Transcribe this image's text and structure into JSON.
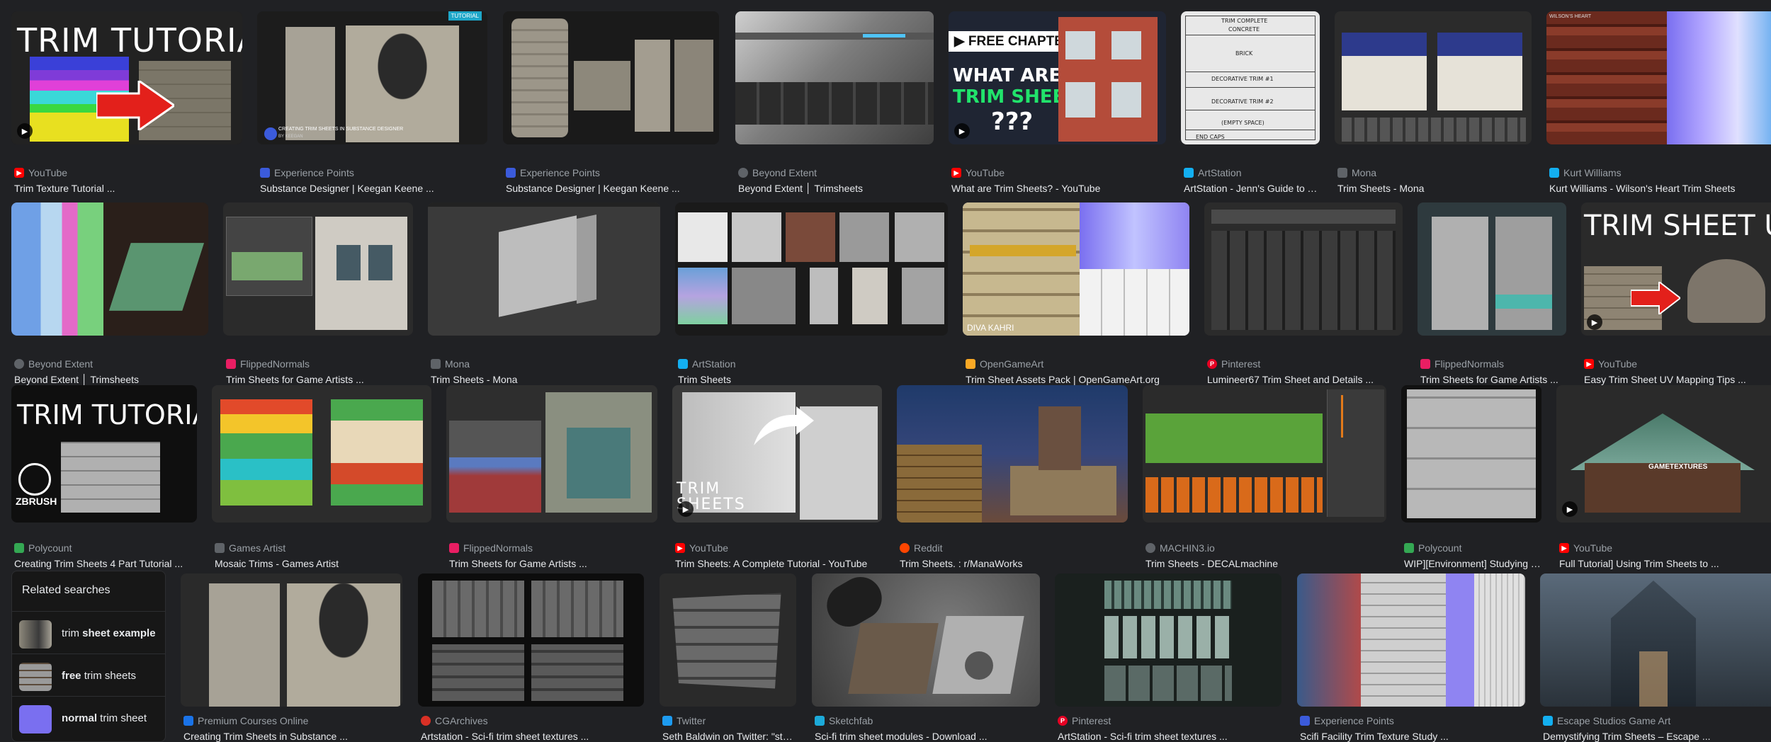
{
  "row1": [
    {
      "source": "YouTube",
      "title": "Trim Texture Tutorial ...",
      "fav": "#ff0000",
      "overlay": "TRIM TUTORIAL",
      "video": true
    },
    {
      "source": "Experience Points",
      "title": "Substance Designer | Keegan Keene ...",
      "fav": "#3b5bdb",
      "badge": "TUTORIAL",
      "caption": "CREATING TRIM SHEETS IN SUBSTANCE DESIGNER",
      "caption2": "BY KEEGAN"
    },
    {
      "source": "Experience Points",
      "title": "Substance Designer | Keegan Keene ...",
      "fav": "#3b5bdb"
    },
    {
      "source": "Beyond Extent",
      "title": "Beyond Extent │ Trimsheets",
      "fav": "#5f6368"
    },
    {
      "source": "YouTube",
      "title": "What are Trim Sheets? - YouTube",
      "fav": "#ff0000",
      "chapter": "▶ FREE CHAPTER",
      "line1": "WHAT ARE",
      "line2": "TRIM SHEETS",
      "line3": "???",
      "video": true
    },
    {
      "source": "ArtStation",
      "title": "ArtStation - Jenn's Guide to Tr...",
      "fav": "#13aff0",
      "sketch": [
        "TRIM COMPLETE",
        "CONCRETE",
        "BRICK",
        "DECORATIVE TRIM #1",
        "DECORATIVE TRIM #2",
        "(EMPTY SPACE)",
        "END CAPS"
      ]
    },
    {
      "source": "Mona",
      "title": "Trim Sheets - Mona",
      "fav": "#5f6368"
    },
    {
      "source": "Kurt Williams",
      "title": "Kurt Williams - Wilson's Heart Trim Sheets",
      "fav": "#13aff0",
      "caption": "WILSON'S HEART"
    }
  ],
  "row2": [
    {
      "source": "Beyond Extent",
      "title": "Beyond Extent │ Trimsheets",
      "fav": "#5f6368"
    },
    {
      "source": "FlippedNormals",
      "title": "Trim Sheets for Game Artists ...",
      "fav": "#e91e63"
    },
    {
      "source": "Mona",
      "title": "Trim Sheets - Mona",
      "fav": "#5f6368"
    },
    {
      "source": "ArtStation",
      "title": "Trim Sheets",
      "fav": "#13aff0"
    },
    {
      "source": "OpenGameArt",
      "title": "Trim Sheet Assets Pack | OpenGameArt.org",
      "fav": "#f9a825",
      "caption": "DIVA KAHRI"
    },
    {
      "source": "Pinterest",
      "title": "Lumineer67 Trim Sheet and Details ...",
      "fav": "#e60023"
    },
    {
      "source": "FlippedNormals",
      "title": "Trim Sheets for Game Artists ...",
      "fav": "#e91e63"
    },
    {
      "source": "YouTube",
      "title": "Easy Trim Sheet UV Mapping Tips ...",
      "fav": "#ff0000",
      "overlay": "TRIM SHEET UVS",
      "video": true
    }
  ],
  "row3": [
    {
      "source": "Polycount",
      "title": "Creating Trim Sheets 4 Part Tutorial ...",
      "fav": "#34a853",
      "overlay": "TRIM TUTORIAL",
      "brand": "ZBRUSH"
    },
    {
      "source": "Games Artist",
      "title": "Mosaic Trims - Games Artist",
      "fav": "#5f6368"
    },
    {
      "source": "FlippedNormals",
      "title": "Trim Sheets for Game Artists ...",
      "fav": "#e91e63"
    },
    {
      "source": "YouTube",
      "title": "Trim Sheets: A Complete Tutorial - YouTube",
      "fav": "#ff0000",
      "overlay1": "TRIM",
      "overlay2": "SHEETS",
      "video": true
    },
    {
      "source": "Reddit",
      "title": "Trim Sheets. : r/ManaWorks",
      "fav": "#ff4500"
    },
    {
      "source": "MACHIN3.io",
      "title": "Trim Sheets - DECALmachine",
      "fav": "#5f6368"
    },
    {
      "source": "Polycount",
      "title": "WIP][Environment] Studying T...",
      "fav": "#34a853"
    },
    {
      "source": "YouTube",
      "title": "Full Tutorial] Using Trim Sheets to ...",
      "fav": "#ff0000",
      "caption": "GAMETEXTURES",
      "video": true
    }
  ],
  "row4": [
    {
      "source": "Premium Courses Online",
      "title": "Creating Trim Sheets in Substance ...",
      "fav": "#1a73e8"
    },
    {
      "source": "CGArchives",
      "title": "Artstation - Sci-fi trim sheet textures ...",
      "fav": "#d93025"
    },
    {
      "source": "Twitter",
      "title": "Seth Baldwin on Twitter: \"styli...",
      "fav": "#1d9bf0"
    },
    {
      "source": "Sketchfab",
      "title": "Sci-fi trim sheet modules - Download ...",
      "fav": "#1caad9"
    },
    {
      "source": "Pinterest",
      "title": "ArtStation - Sci-fi trim sheet textures ...",
      "fav": "#e60023"
    },
    {
      "source": "Experience Points",
      "title": "Scifi Facility Trim Texture Study ...",
      "fav": "#3b5bdb"
    },
    {
      "source": "Escape Studios Game Art",
      "title": "Demystifying Trim Sheets – Escape ...",
      "fav": "#13aff0"
    }
  ],
  "related": {
    "heading": "Related searches",
    "items": [
      {
        "pre": "trim ",
        "bold": "sheet example",
        "post": ""
      },
      {
        "pre": "",
        "bold": "free",
        "post": " trim sheets"
      },
      {
        "pre": "",
        "bold": "normal",
        "post": " trim sheet"
      }
    ]
  },
  "colors": {
    "background": "#202124",
    "title": "#e8eaed",
    "source": "#9aa0a6"
  }
}
